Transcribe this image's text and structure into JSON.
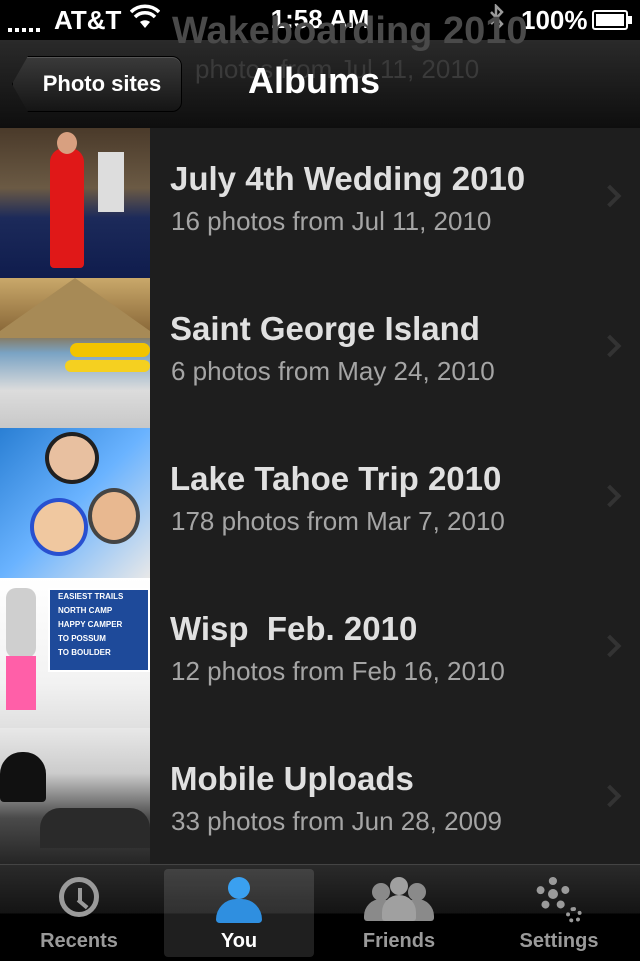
{
  "status_bar": {
    "carrier": "AT&T",
    "time": "1:58 AM",
    "battery": "100%"
  },
  "nav": {
    "ghost_title": "Wakeboarding 2010",
    "ghost_subtitle": "photos from Jul 11, 2010",
    "back_label": "Photo sites",
    "title": "Albums"
  },
  "albums": [
    {
      "title": "July 4th Wedding 2010",
      "subtitle": "16 photos from Jul 11, 2010"
    },
    {
      "title": "Saint George Island",
      "subtitle": "6 photos from May 24, 2010"
    },
    {
      "title": "Lake Tahoe Trip 2010",
      "subtitle": "178 photos from Mar 7, 2010"
    },
    {
      "title": "Wisp  Feb. 2010",
      "subtitle": "12 photos from Feb 16, 2010"
    },
    {
      "title": "Mobile Uploads",
      "subtitle": "33 photos from Jun 28, 2009"
    }
  ],
  "sign_lines": [
    "EASIEST TRAILS",
    "NORTH CAMP",
    "HAPPY CAMPER",
    "TO POSSUM",
    "TO BOULDER"
  ],
  "tabs": [
    {
      "label": "Recents",
      "icon": "clock-icon"
    },
    {
      "label": "You",
      "icon": "person-icon",
      "active": true
    },
    {
      "label": "Friends",
      "icon": "people-icon"
    },
    {
      "label": "Settings",
      "icon": "gear-icon"
    }
  ],
  "colors": {
    "active_tab_icon": "#3aa0f0",
    "list_background": "#1e1e1e"
  }
}
